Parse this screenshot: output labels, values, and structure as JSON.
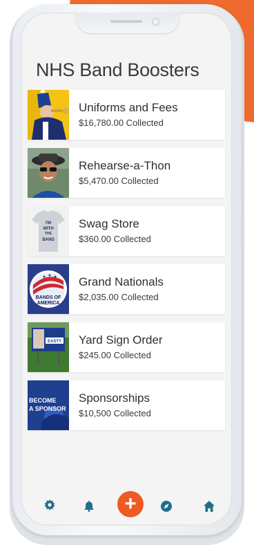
{
  "app": {
    "title": "NHS Band Boosters"
  },
  "items": [
    {
      "title": "Uniforms and Fees",
      "subtitle": "$16,780.00 Collected",
      "thumb": "band-member-trumpet"
    },
    {
      "title": "Rehearse-a-Thon",
      "subtitle": "$5,470.00 Collected",
      "thumb": "student-portrait"
    },
    {
      "title": "Swag Store",
      "subtitle": "$360.00 Collected",
      "thumb": "t-shirt",
      "thumb_text": [
        "I'M",
        "WITH",
        "THE",
        "BAND"
      ]
    },
    {
      "title": "Grand Nationals",
      "subtitle": "$2,035.00 Collected",
      "thumb": "bands-of-america-logo",
      "thumb_text": [
        "BANDS OF",
        "AMERICA"
      ]
    },
    {
      "title": "Yard Sign Order",
      "subtitle": "$245.00 Collected",
      "thumb": "yard-sign",
      "thumb_text": [
        "EASTY"
      ]
    },
    {
      "title": "Sponsorships",
      "subtitle": "$10,500 Collected",
      "thumb": "become-a-sponsor",
      "thumb_text": [
        "BECOME",
        "A SPONSOR"
      ]
    }
  ],
  "nav": {
    "items": [
      "settings-icon",
      "bell-icon",
      "add-icon",
      "compass-icon",
      "home-icon"
    ],
    "plus_label": "+"
  },
  "colors": {
    "accent": "#ee5a24",
    "nav_icon": "#1f6f8b",
    "background_shape": "#ef6a2e"
  }
}
